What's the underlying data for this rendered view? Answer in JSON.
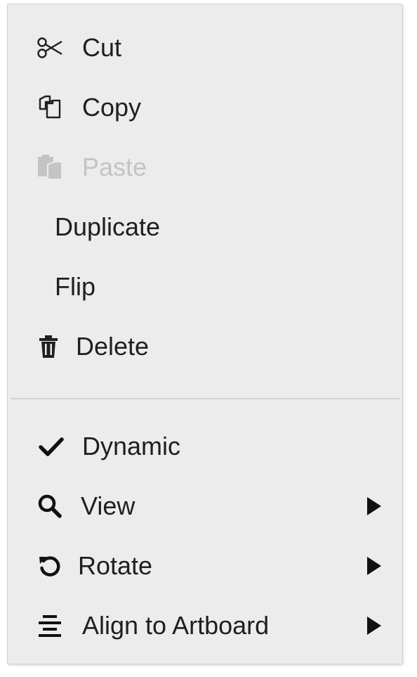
{
  "menu": {
    "items": [
      {
        "label": "Cut",
        "icon": "scissors-icon",
        "disabled": false,
        "submenu": false
      },
      {
        "label": "Copy",
        "icon": "copy-icon",
        "disabled": false,
        "submenu": false
      },
      {
        "label": "Paste",
        "icon": "paste-icon",
        "disabled": true,
        "submenu": false
      },
      {
        "label": "Duplicate",
        "icon": "",
        "disabled": false,
        "submenu": false
      },
      {
        "label": "Flip",
        "icon": "",
        "disabled": false,
        "submenu": false
      },
      {
        "label": "Delete",
        "icon": "trash-icon",
        "disabled": false,
        "submenu": false
      },
      {
        "label": "Dynamic",
        "icon": "check-icon",
        "disabled": false,
        "submenu": false,
        "checked": true
      },
      {
        "label": "View",
        "icon": "search-icon",
        "disabled": false,
        "submenu": true
      },
      {
        "label": "Rotate",
        "icon": "rotate-icon",
        "disabled": false,
        "submenu": true
      },
      {
        "label": "Align to Artboard",
        "icon": "align-center-icon",
        "disabled": false,
        "submenu": true
      }
    ]
  },
  "colors": {
    "background": "#ececec",
    "text": "#1f1f1f",
    "disabled_text": "#c4c4c4",
    "separator": "#d2d2d2"
  }
}
